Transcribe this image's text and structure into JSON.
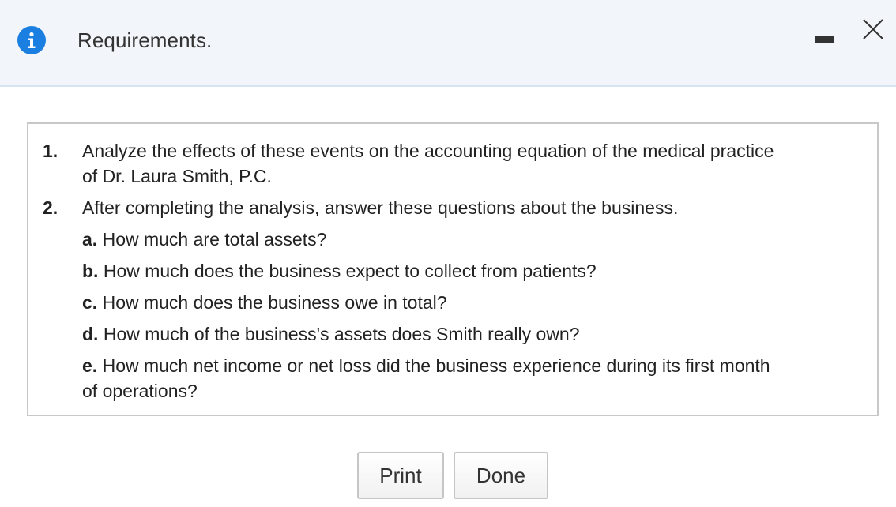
{
  "header": {
    "title": "Requirements.",
    "icon": "info-icon",
    "accent_color": "#1a7fe0"
  },
  "window_controls": {
    "minimize_icon": "minimize-icon",
    "close_icon": "close-icon"
  },
  "requirements": [
    {
      "number": "1.",
      "text_line1": "Analyze the effects of these events on the accounting equation of the medical practice",
      "text_line2": "of Dr. Laura Smith, P.C."
    },
    {
      "number": "2.",
      "text": "After completing the analysis, answer these questions about the business.",
      "subitems": [
        {
          "letter": "a.",
          "text": "How much are total assets?"
        },
        {
          "letter": "b.",
          "text": "How much does the business expect to collect from patients?"
        },
        {
          "letter": "c.",
          "text": "How much does the business owe in total?"
        },
        {
          "letter": "d.",
          "text": "How much of the business's assets does Smith really own?"
        },
        {
          "letter": "e.",
          "text_line1": "How much net income or net loss did the business experience during its first month",
          "text_line2": "of operations?"
        }
      ]
    }
  ],
  "buttons": {
    "print_label": "Print",
    "done_label": "Done"
  }
}
